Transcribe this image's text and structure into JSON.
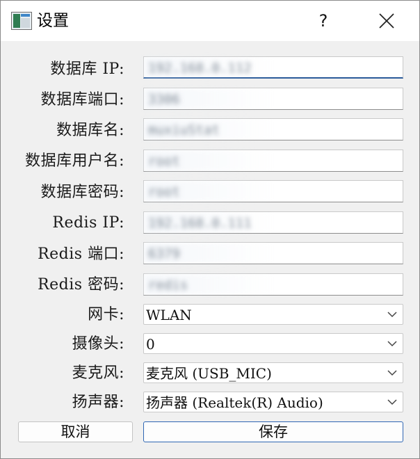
{
  "window": {
    "title": "设置",
    "help_label": "?"
  },
  "form": {
    "db_ip": {
      "label": "数据库 IP:",
      "value": "192.168.0.112"
    },
    "db_port": {
      "label": "数据库端口:",
      "value": "3306"
    },
    "db_name": {
      "label": "数据库名:",
      "value": "muxiuStat"
    },
    "db_user": {
      "label": "数据库用户名:",
      "value": "root"
    },
    "db_password": {
      "label": "数据库密码:",
      "value": "root"
    },
    "redis_ip": {
      "label": "Redis IP:",
      "value": "192.168.0.111"
    },
    "redis_port": {
      "label": "Redis 端口:",
      "value": "6379"
    },
    "redis_password": {
      "label": "Redis 密码:",
      "value": "redis"
    },
    "nic": {
      "label": "网卡:",
      "value": "WLAN"
    },
    "camera": {
      "label": "摄像头:",
      "value": "0"
    },
    "microphone": {
      "label": "麦克风:",
      "value": "麦克风 (USB_MIC)"
    },
    "speaker": {
      "label": "扬声器:",
      "value": "扬声器 (Realtek(R) Audio)"
    }
  },
  "buttons": {
    "cancel": "取消",
    "save": "保存"
  },
  "colors": {
    "accent": "#2a5b9a",
    "window_bg": "#f0f0f0"
  },
  "icons": {
    "app": "settings-app-icon",
    "close": "close-icon",
    "dropdown": "chevron-down-icon"
  }
}
